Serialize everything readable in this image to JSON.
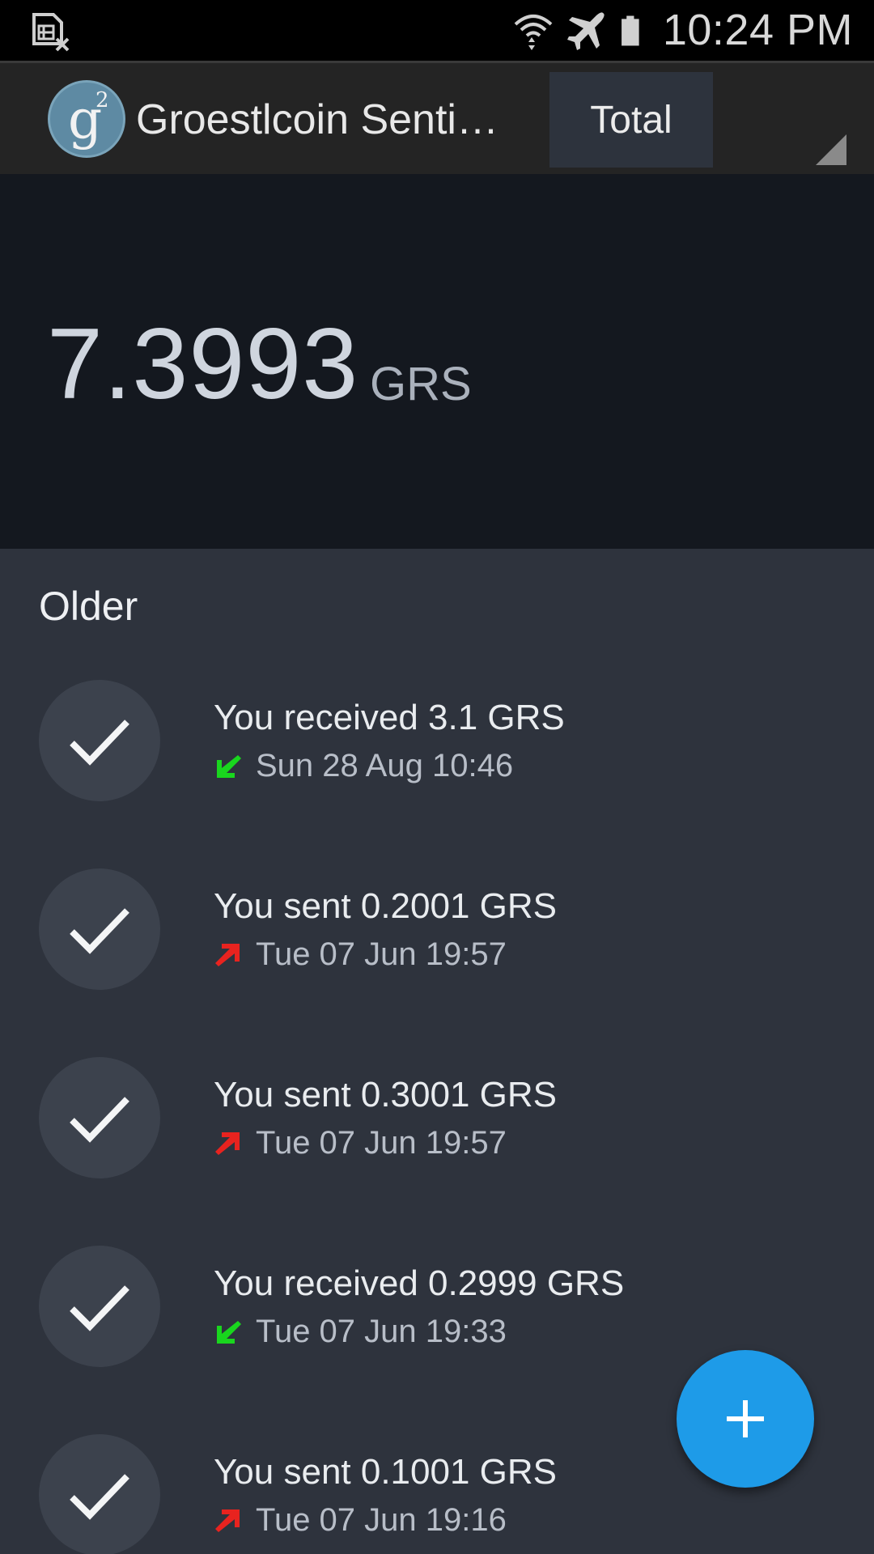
{
  "status_bar": {
    "time": "10:24 PM",
    "icons": [
      "sim-missing-icon",
      "wifi-icon",
      "airplane-mode-icon",
      "battery-icon"
    ]
  },
  "app_bar": {
    "logo_letter": "g",
    "logo_superscript": "2",
    "title": "Groestlcoin Senti…",
    "tab_label": "Total"
  },
  "balance": {
    "amount": "7.3993",
    "unit": "GRS"
  },
  "transactions": {
    "section_label": "Older",
    "items": [
      {
        "title": "You received 3.1 GRS",
        "date": "Sun 28 Aug 10:46",
        "direction": "received"
      },
      {
        "title": "You sent 0.2001 GRS",
        "date": "Tue 07 Jun 19:57",
        "direction": "sent"
      },
      {
        "title": "You sent 0.3001 GRS",
        "date": "Tue 07 Jun 19:57",
        "direction": "sent"
      },
      {
        "title": "You received 0.2999 GRS",
        "date": "Tue 07 Jun 19:33",
        "direction": "received"
      },
      {
        "title": "You sent 0.1001 GRS",
        "date": "Tue 07 Jun 19:16",
        "direction": "sent"
      }
    ]
  },
  "colors": {
    "received_arrow": "#19d61e",
    "sent_arrow": "#e8231f",
    "fab": "#1e9be8"
  }
}
